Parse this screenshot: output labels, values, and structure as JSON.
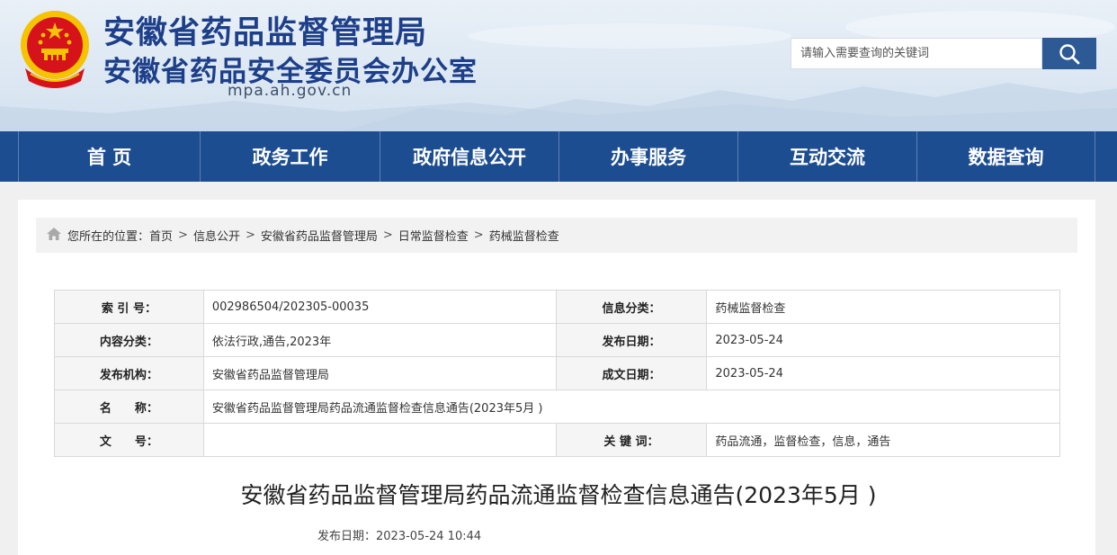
{
  "header": {
    "title": "安徽省药品监督管理局",
    "subtitle": "安徽省药品安全委员会办公室",
    "domain": "mpa.ah.gov.cn",
    "search_placeholder": "请输入需要查询的关键词",
    "emblem_icon": "national-emblem-icon",
    "search_icon": "magnifier-icon"
  },
  "nav": {
    "items": [
      "首 页",
      "政务工作",
      "政府信息公开",
      "办事服务",
      "互动交流",
      "数据查询"
    ]
  },
  "breadcrumb": {
    "icon": "home-icon",
    "prefix": "您所在的位置：",
    "items": [
      "首页",
      "信息公开",
      "安徽省药品监督管理局",
      "日常监督检查",
      "药械监督检查"
    ],
    "separator": ">"
  },
  "meta": {
    "index_label": "索 引 号：",
    "index_value": "002986504/202305-00035",
    "category_label": "信息分类：",
    "category_value": "药械监督检查",
    "content_label": "内容分类：",
    "content_value": "依法行政,通告,2023年",
    "publish_label": "发布日期：",
    "publish_value": "2023-05-24",
    "org_label": "发布机构：",
    "org_value": "安徽省药品监督管理局",
    "created_label": "成文日期：",
    "created_value": "2023-05-24",
    "name_label": "名　　称：",
    "name_value": "安徽省药品监督管理局药品流通监督检查信息通告(2023年5月 )",
    "docno_label": "文　　号：",
    "docno_value": "",
    "keywords_label": "关 键 词：",
    "keywords_value": "药品流通，监督检查，信息，通告"
  },
  "article": {
    "title": "安徽省药品监督管理局药品流通监督检查信息通告(2023年5月 )",
    "date": "发布日期：2023-05-24 10:44"
  },
  "colors": {
    "brand_blue": "#1d4d91",
    "title_blue": "#1d3f8a",
    "emblem_red": "#d6131a",
    "emblem_gold": "#f5c300"
  }
}
